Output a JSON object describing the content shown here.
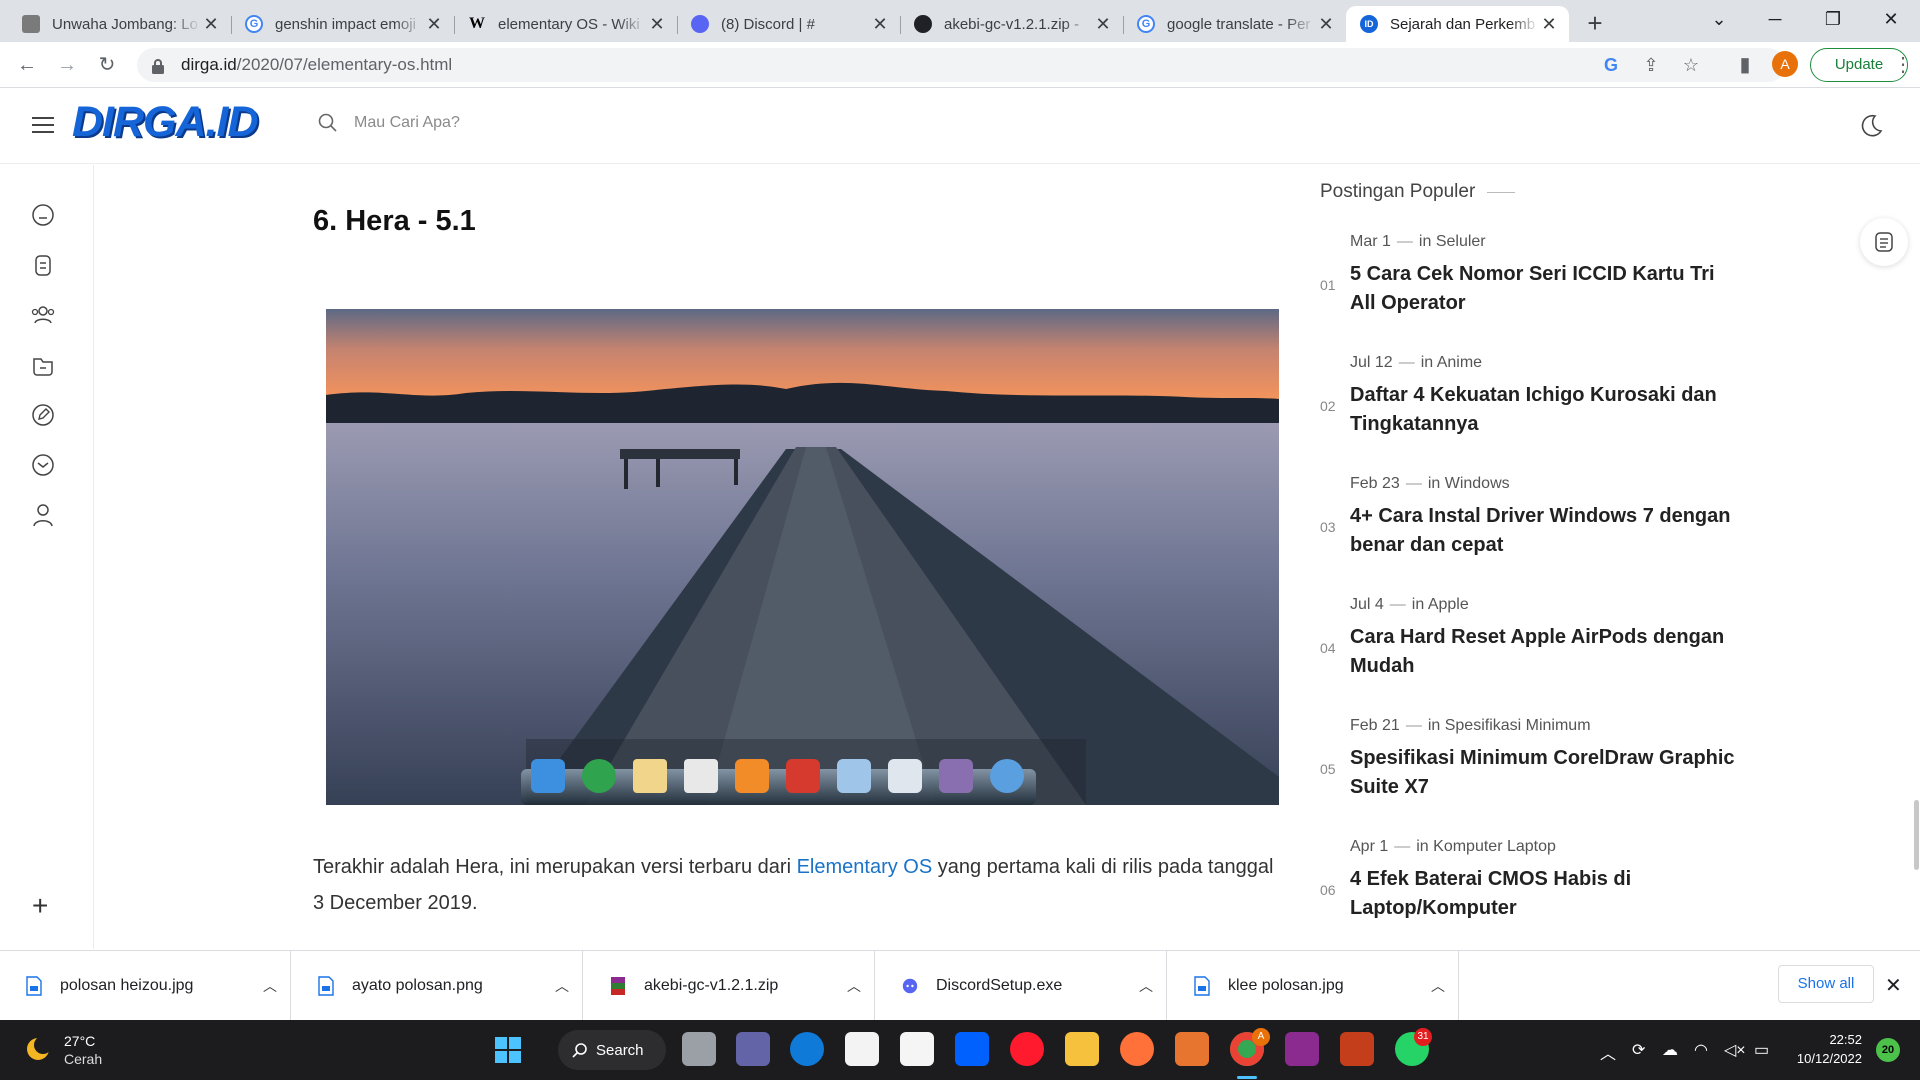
{
  "browser": {
    "tabs": [
      {
        "title": "Unwaha Jombang: Lo",
        "favicon_color": "#7a7a7a",
        "favicon_glyph": ""
      },
      {
        "title": "genshin impact emoji",
        "favicon_color": "#4285f4",
        "favicon_glyph": "G"
      },
      {
        "title": "elementary OS - Wiki",
        "favicon_color": "#000000",
        "favicon_glyph": "W"
      },
      {
        "title": "(8) Discord | #",
        "favicon_color": "#5865f2",
        "favicon_glyph": ""
      },
      {
        "title": "akebi-gc-v1.2.1.zip -",
        "favicon_color": "#202124",
        "favicon_glyph": ""
      },
      {
        "title": "google translate - Per",
        "favicon_color": "#4285f4",
        "favicon_glyph": "G"
      },
      {
        "title": "Sejarah dan Perkemb",
        "favicon_color": "#1565d8",
        "favicon_glyph": "ID"
      }
    ],
    "active_tab_index": 6,
    "url_host": "dirga.id",
    "url_path": "/2020/07/elementary-os.html",
    "profile_initial": "A",
    "update_label": "Update"
  },
  "site": {
    "logo": "DIRGA.ID",
    "search_placeholder": "Mau Cari Apa?",
    "brand_color": "#1565d8"
  },
  "article": {
    "heading": "6. Hera - 5.1",
    "para_before_link": "Terakhir adalah Hera, ini merupakan versi terbaru dari ",
    "link_text": "Elementary OS",
    "para_after_link": " yang pertama kali di rilis pada tanggal 3 December 2019."
  },
  "popular": {
    "heading": "Postingan Populer",
    "in_label": "in",
    "items": [
      {
        "num": "01",
        "date": "Mar 1",
        "category": "Seluler",
        "title": "5 Cara Cek Nomor Seri ICCID Kartu Tri All Operator"
      },
      {
        "num": "02",
        "date": "Jul 12",
        "category": "Anime",
        "title": "Daftar 4 Kekuatan Ichigo Kurosaki dan Tingkatannya"
      },
      {
        "num": "03",
        "date": "Feb 23",
        "category": "Windows",
        "title": "4+ Cara Instal Driver Windows 7 dengan benar dan cepat"
      },
      {
        "num": "04",
        "date": "Jul 4",
        "category": "Apple",
        "title": "Cara Hard Reset Apple AirPods dengan Mudah"
      },
      {
        "num": "05",
        "date": "Feb 21",
        "category": "Spesifikasi Minimum",
        "title": "Spesifikasi Minimum CorelDraw Graphic Suite X7"
      },
      {
        "num": "06",
        "date": "Apr 1",
        "category": "Komputer Laptop",
        "title": "4 Efek Baterai CMOS Habis di Laptop/Komputer"
      }
    ]
  },
  "downloads": {
    "items": [
      {
        "name": "polosan heizou.jpg",
        "icon": "image-file-icon"
      },
      {
        "name": "ayato polosan.png",
        "icon": "image-file-icon"
      },
      {
        "name": "akebi-gc-v1.2.1.zip",
        "icon": "zip-file-icon"
      },
      {
        "name": "DiscordSetup.exe",
        "icon": "discord-icon"
      },
      {
        "name": "klee polosan.jpg",
        "icon": "image-file-icon"
      }
    ],
    "show_all_label": "Show all"
  },
  "taskbar": {
    "temperature": "27°C",
    "weather": "Cerah",
    "search_label": "Search",
    "time": "22:52",
    "date": "10/12/2022",
    "notification_count": "20",
    "chrome_badge": "A",
    "whatsapp_badge": "31"
  }
}
